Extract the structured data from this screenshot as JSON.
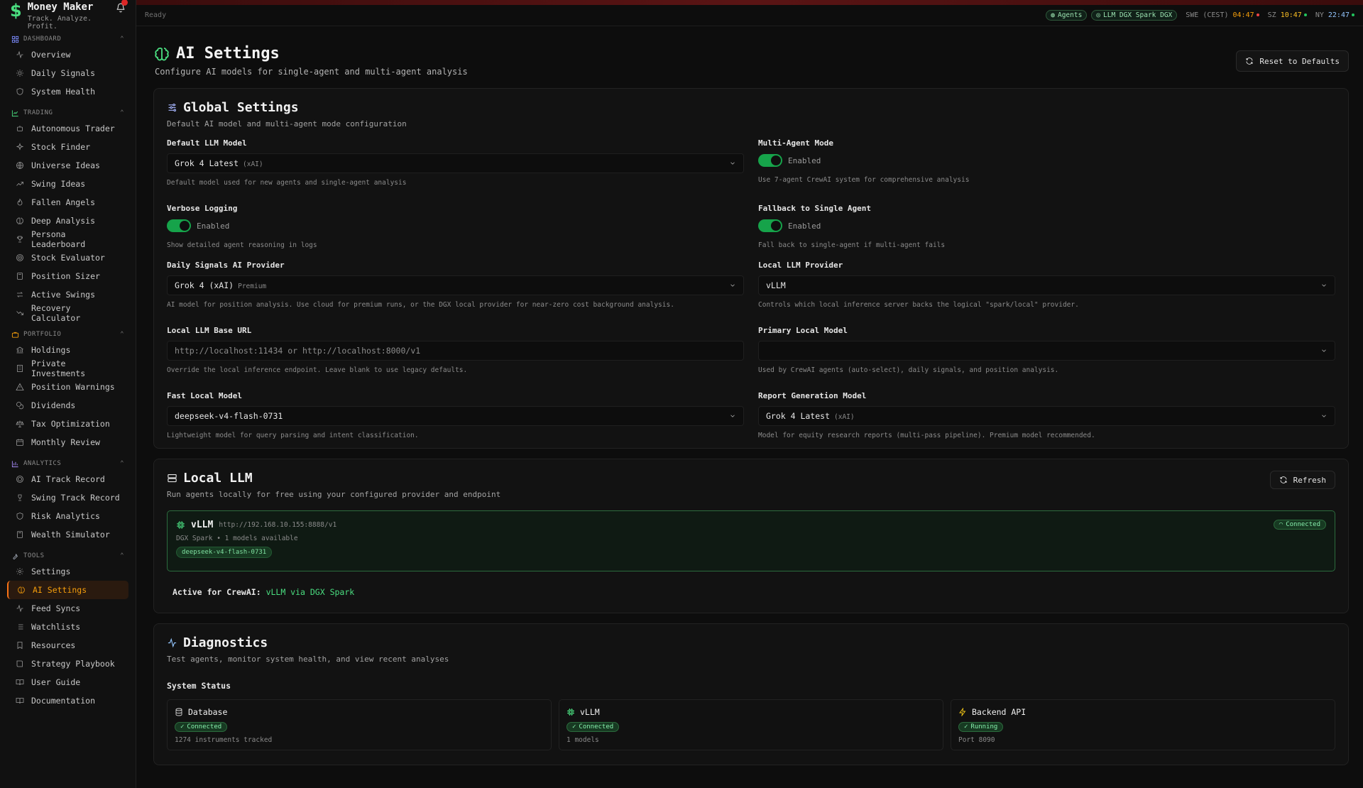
{
  "app": {
    "name": "Money Maker",
    "tagline": "Track. Analyze. Profit."
  },
  "sidebar": {
    "sections": [
      {
        "title": "DASHBOARD",
        "items": [
          "Overview",
          "Daily Signals",
          "System Health"
        ]
      },
      {
        "title": "TRADING",
        "items": [
          "Autonomous Trader",
          "Stock Finder",
          "Universe Ideas",
          "Swing Ideas",
          "Fallen Angels",
          "Deep Analysis",
          "Persona Leaderboard",
          "Stock Evaluator",
          "Position Sizer",
          "Active Swings",
          "Recovery Calculator"
        ]
      },
      {
        "title": "PORTFOLIO",
        "items": [
          "Holdings",
          "Private Investments",
          "Position Warnings",
          "Dividends",
          "Tax Optimization",
          "Monthly Review"
        ]
      },
      {
        "title": "ANALYTICS",
        "items": [
          "AI Track Record",
          "Swing Track Record",
          "Risk Analytics",
          "Wealth Simulator"
        ]
      },
      {
        "title": "TOOLS",
        "items": [
          "Settings",
          "AI Settings",
          "Feed Syncs",
          "Watchlists",
          "Resources",
          "Strategy Playbook",
          "User Guide",
          "Documentation"
        ]
      }
    ],
    "active_item": "AI Settings"
  },
  "topbar": {
    "status": "Ready",
    "pill_agents": "Agents",
    "pill_llm": "LLM DGX Spark DGX",
    "clock1_label": "SWE",
    "clock1_tz": "(CEST)",
    "clock1_time": "04:47",
    "clock2_label": "SZ",
    "clock2_time": "10:47",
    "clock3_label": "NY",
    "clock3_time": "22:47"
  },
  "page": {
    "title": "AI Settings",
    "subtitle": "Configure AI models for single-agent and multi-agent analysis",
    "reset_label": "Reset to Defaults"
  },
  "global": {
    "title": "Global Settings",
    "subtitle": "Default AI model and multi-agent mode configuration",
    "default_llm": {
      "label": "Default LLM Model",
      "value": "Grok 4 Latest",
      "sub": "(xAI)",
      "hint": "Default model used for new agents and single-agent analysis"
    },
    "multi_agent": {
      "label": "Multi-Agent Mode",
      "state": "Enabled",
      "hint": "Use 7-agent CrewAI system for comprehensive analysis"
    },
    "verbose": {
      "label": "Verbose Logging",
      "state": "Enabled",
      "hint": "Show detailed agent reasoning in logs"
    },
    "fallback": {
      "label": "Fallback to Single Agent",
      "state": "Enabled",
      "hint": "Fall back to single-agent if multi-agent fails"
    },
    "daily_provider": {
      "label": "Daily Signals AI Provider",
      "value": "Grok 4 (xAI)",
      "sub": "Premium",
      "hint": "AI model for position analysis. Use cloud for premium runs, or the DGX local provider for near-zero cost background analysis."
    },
    "local_provider": {
      "label": "Local LLM Provider",
      "value": "vLLM",
      "hint": "Controls which local inference server backs the logical \"spark/local\" provider."
    },
    "base_url": {
      "label": "Local LLM Base URL",
      "placeholder": "http://localhost:11434 or http://localhost:8000/v1",
      "hint": "Override the local inference endpoint. Leave blank to use legacy defaults."
    },
    "primary_local": {
      "label": "Primary Local Model",
      "value": "",
      "hint": "Used by CrewAI agents (auto-select), daily signals, and position analysis."
    },
    "fast_local": {
      "label": "Fast Local Model",
      "value": "deepseek-v4-flash-0731",
      "hint": "Lightweight model for query parsing and intent classification."
    },
    "report_model": {
      "label": "Report Generation Model",
      "value": "Grok 4 Latest",
      "sub": "(xAI)",
      "hint": "Model for equity research reports (multi-pass pipeline). Premium model recommended."
    }
  },
  "local_llm": {
    "title": "Local LLM",
    "subtitle": "Run agents locally for free using your configured provider and endpoint",
    "refresh_label": "Refresh",
    "server_name": "vLLM",
    "server_url": "http://192.168.10.155:8888/v1",
    "server_meta": "DGX Spark • 1 models available",
    "model_chip": "deepseek-v4-flash-0731",
    "status": "Connected",
    "active_label": "Active for CrewAI:",
    "active_value": "vLLM via DGX Spark"
  },
  "diagnostics": {
    "title": "Diagnostics",
    "subtitle": "Test agents, monitor system health, and view recent analyses",
    "system_status": "System Status",
    "cards": [
      {
        "name": "Database",
        "status": "Connected",
        "meta": "1274 instruments tracked"
      },
      {
        "name": "vLLM",
        "status": "Connected",
        "meta": "1 models"
      },
      {
        "name": "Backend API",
        "status": "Running",
        "meta": "Port 8090"
      }
    ]
  },
  "colors": {
    "accent": "#4ade80",
    "active_nav": "#f59e0b",
    "brand": "#4ade80"
  }
}
